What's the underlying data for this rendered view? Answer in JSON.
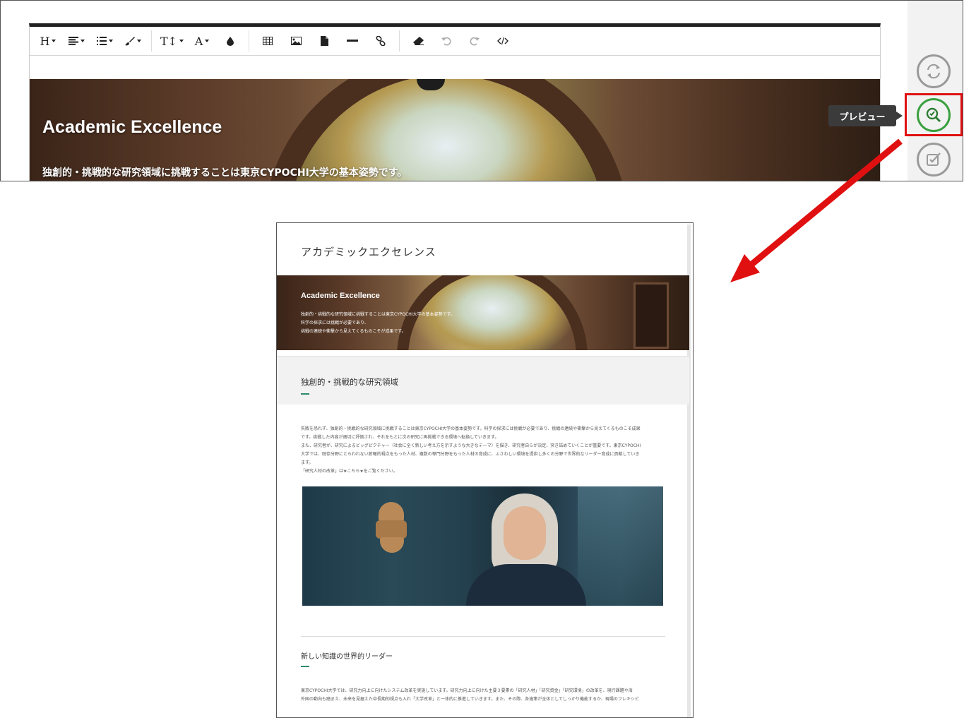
{
  "editor": {
    "toolbar": {
      "heading": "H",
      "text_size": "T↕",
      "font_color": "A"
    },
    "hero": {
      "title": "Academic Excellence",
      "subtitle": "独創的・挑戦的な研究領域に挑戦することは東京CYPOCHI大学の基本姿勢です。"
    },
    "sidebar": {
      "tooltip": "プレビュー"
    }
  },
  "preview": {
    "page_title": "アカデミックエクセレンス",
    "hero_title": "Academic Excellence",
    "hero_lines": [
      "独創的・挑戦的な研究領域に挑戦することは東京CYPOCHI大学の基本姿勢です。",
      "科学の探求には挑戦が必要であり、",
      "挑戦の連続や衝撃から見えてくるものこそが成果です。"
    ],
    "section1_heading": "独創的・挑戦的な研究領域",
    "section1_paragraph": [
      "失敗を恐れず、独創的・挑戦的な研究領域に挑戦することは東京CYPOCHI大学の基本姿勢です。科学の探求には挑戦が必要であり、挑戦の連続や衝撃から見えてくるものこそ成果",
      "です。挑戦した内容が適切に評価され、それをもとに次の研究に再挑戦できる環境へ転換していきます。",
      "また、研究者が、研究によるビッグピクチャー（社会に全く新しい考え方を示すような大きなテーマ）を描き、研究者自らが決定、突き詰めていくことが重要です。東京CYPOCHI",
      "大学では、既存分野にとらわれない俯瞰的視点をもった人材、複数の専門分野をもった人材の育成に、ふさわしい環境を提供し多くの分野で世界的なリーダー育成に貢献していき",
      "ます。",
      "「研究人材の改革」は★こちら★をご覧ください。"
    ],
    "section2_heading": "新しい知識の世界的リーダー",
    "section2_paragraph": [
      "東京CYPOCHI大学では、研究力向上に向けたシステム改革を実施しています。研究力向上に向けた主要３要素の「研究人材」「研究資金」「研究環境」の改革を、現行課題や海",
      "外国の動向も踏まえ、未来を見据えた中長期的視点も入れ「大学改革」と一体的に推進していきます。また、その際、各施策が全体としてしっかり機能するか、現場のフレキシビ"
    ]
  },
  "colors": {
    "highlight": "#e01010",
    "preview_green": "#3aa03f",
    "accent_line": "#2f8a6a"
  },
  "icons": {
    "sidebar": [
      "refresh-icon",
      "preview-search-icon",
      "publish-check-icon"
    ]
  }
}
